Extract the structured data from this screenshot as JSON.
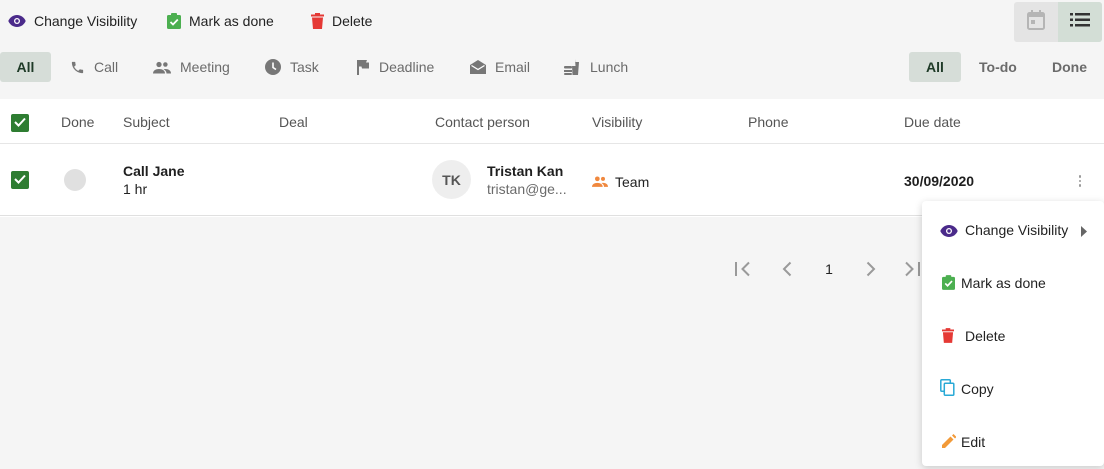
{
  "bulk_actions": {
    "change_visibility": "Change Visibility",
    "mark_as_done": "Mark as done",
    "delete": "Delete"
  },
  "view_toggle": {
    "calendar_icon": "calendar-icon",
    "list_icon": "list-icon",
    "active": "list"
  },
  "type_filters": [
    "All",
    "Call",
    "Meeting",
    "Task",
    "Deadline",
    "Email",
    "Lunch"
  ],
  "status_filters": [
    "All",
    "To-do",
    "Done"
  ],
  "table": {
    "headers": {
      "done": "Done",
      "subject": "Subject",
      "deal": "Deal",
      "contact": "Contact person",
      "visibility": "Visibility",
      "phone": "Phone",
      "due": "Due date"
    },
    "rows": [
      {
        "subject": "Call Jane",
        "duration": "1 hr",
        "deal": "",
        "initials": "TK",
        "contact_name": "Tristan Kan",
        "contact_email": "tristan@ge...",
        "visibility": "Team",
        "phone": "",
        "due": "30/09/2020"
      }
    ]
  },
  "pagination": {
    "current_page": "1"
  },
  "context_menu": {
    "items": [
      "Change Visibility",
      "Mark as done",
      "Delete",
      "Copy",
      "Edit"
    ]
  },
  "colors": {
    "accent_green": "#2e7d32",
    "active_tab_bg": "#d6ddd8",
    "visibility_purple": "#4a2a8a",
    "done_green": "#4caf50",
    "delete_red": "#e53935",
    "team_orange": "#f0883e",
    "copy_blue": "#29a9d6",
    "edit_orange": "#f29a38"
  }
}
